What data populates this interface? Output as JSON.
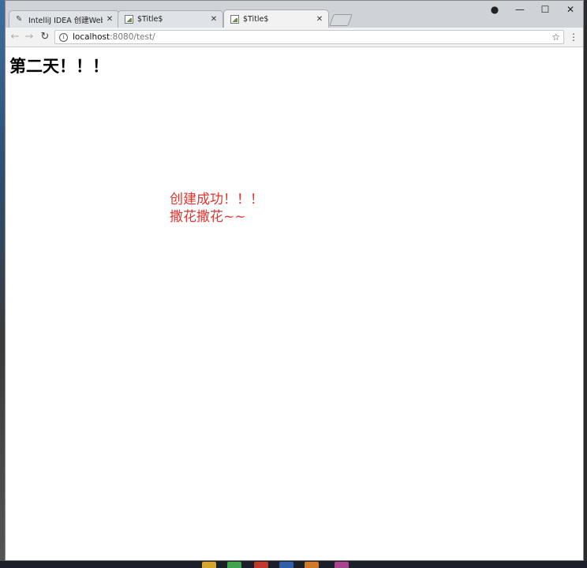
{
  "browser": {
    "tabs": [
      {
        "title": "IntelliJ IDEA 创建Web项",
        "icon": "intellij-icon",
        "active": false
      },
      {
        "title": "$Title$",
        "icon": "image-icon",
        "active": false
      },
      {
        "title": "$Title$",
        "icon": "image-icon",
        "active": true
      }
    ],
    "address": {
      "host": "localhost",
      "path": ":8080/test/"
    }
  },
  "page": {
    "heading": "第二天！！！",
    "message_line1": "创建成功！！！",
    "message_line2": "撒花撒花~~"
  },
  "colors": {
    "message": "#e0362e",
    "tabbar": "#cfd3d8"
  }
}
